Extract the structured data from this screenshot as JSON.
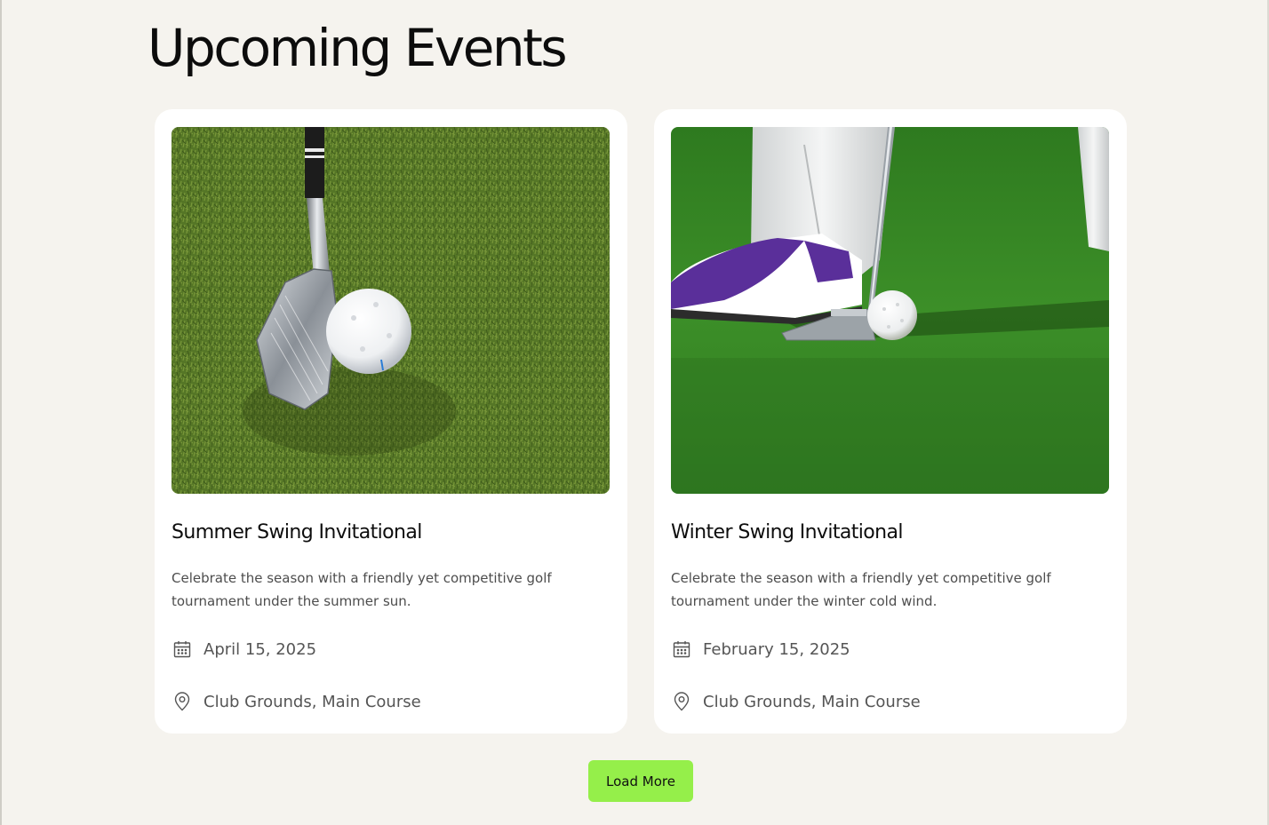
{
  "page": {
    "heading": "Upcoming Events",
    "load_more_label": "Load More"
  },
  "colors": {
    "background": "#f5f3ee",
    "card": "#ffffff",
    "accent_button": "#95ef4a"
  },
  "events": [
    {
      "title": "Summer Swing Invitational",
      "description": "Celebrate the season with a friendly yet competitive golf tournament under the summer sun.",
      "date": "April 15, 2025",
      "location": "Club Grounds, Main Course",
      "image": "golf-iron-and-ball-on-grass",
      "date_icon": "calendar-icon",
      "location_icon": "map-pin-icon"
    },
    {
      "title": "Winter Swing Invitational",
      "description": "Celebrate the season with a friendly yet competitive golf tournament under the winter cold wind.",
      "date": "February 15, 2025",
      "location": "Club Grounds, Main Course",
      "image": "golfer-putting-on-green",
      "date_icon": "calendar-icon",
      "location_icon": "map-pin-icon"
    }
  ]
}
